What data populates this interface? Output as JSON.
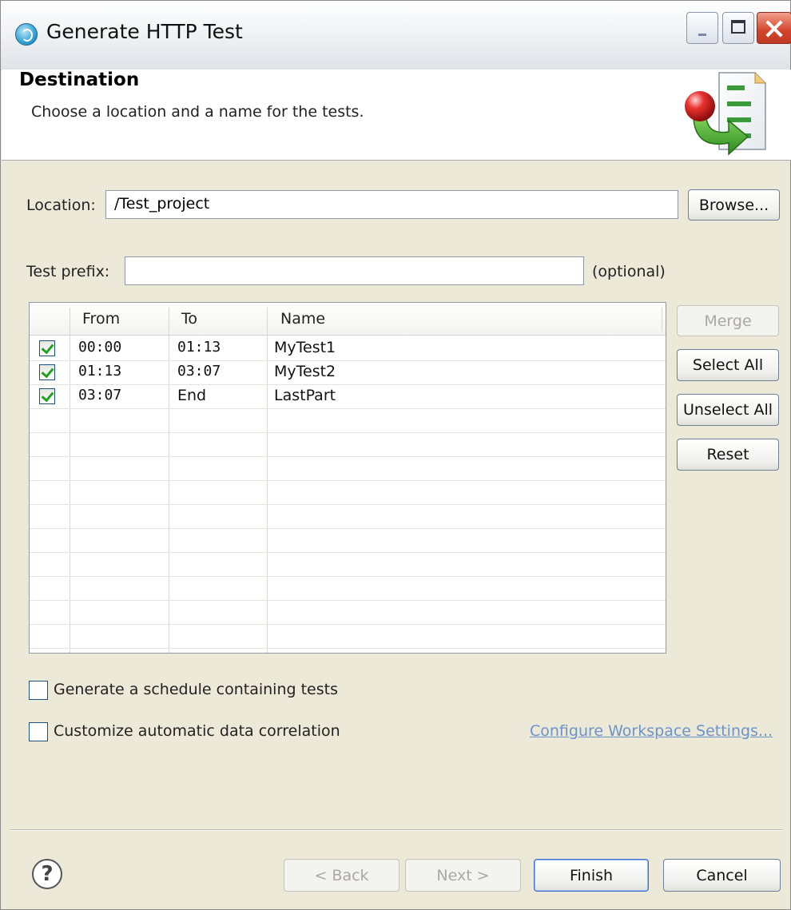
{
  "window": {
    "title": "Generate HTTP Test",
    "title_icon": "rpt-globe-icon"
  },
  "header": {
    "title": "Destination",
    "description": "Choose a location and a name for the tests.",
    "icon": "wizard-generate-icon"
  },
  "location": {
    "label": "Location:",
    "value": "/Test_project",
    "browse_label": "Browse..."
  },
  "prefix": {
    "label": "Test prefix:",
    "value": "",
    "hint": "(optional)"
  },
  "table": {
    "columns": [
      "From",
      "To",
      "Name"
    ],
    "rows": [
      {
        "checked": true,
        "from": "00:00",
        "to": "01:13",
        "name": "MyTest1"
      },
      {
        "checked": true,
        "from": "01:13",
        "to": "03:07",
        "name": "MyTest2"
      },
      {
        "checked": true,
        "from": "03:07",
        "to": "End",
        "name": "LastPart"
      }
    ]
  },
  "side_buttons": {
    "merge": "Merge",
    "select_all": "Select All",
    "unselect_all": "Unselect All",
    "reset": "Reset"
  },
  "options": {
    "schedule_label": "Generate a schedule containing tests",
    "schedule_checked": false,
    "correlation_label": "Customize automatic data correlation",
    "correlation_checked": false,
    "workspace_link": "Configure Workspace Settings..."
  },
  "footer": {
    "help_glyph": "?",
    "back": "< Back",
    "next": "Next >",
    "finish": "Finish",
    "cancel": "Cancel"
  }
}
